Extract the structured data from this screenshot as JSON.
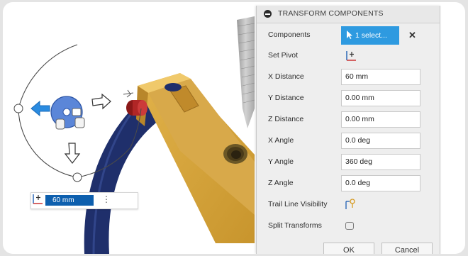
{
  "float_bar": {
    "distance_value": "60 mm"
  },
  "panel": {
    "title": "TRANSFORM COMPONENTS",
    "rows": {
      "components": {
        "label": "Components",
        "value": "1 select..."
      },
      "set_pivot": {
        "label": "Set Pivot"
      },
      "x_distance": {
        "label": "X Distance",
        "value": "60 mm"
      },
      "y_distance": {
        "label": "Y Distance",
        "value": "0.00 mm"
      },
      "z_distance": {
        "label": "Z Distance",
        "value": "0.00 mm"
      },
      "x_angle": {
        "label": "X Angle",
        "value": "0.0 deg"
      },
      "y_angle": {
        "label": "Y Angle",
        "value": "360 deg"
      },
      "z_angle": {
        "label": "Z Angle",
        "value": "0.0 deg"
      },
      "trail": {
        "label": "Trail Line Visibility"
      },
      "split": {
        "label": "Split Transforms"
      }
    },
    "clear_glyph": "✕",
    "ok_label": "OK",
    "cancel_label": "Cancel"
  },
  "colors": {
    "accent": "#2e9ae0",
    "float_input": "#0d5fae",
    "yellow_part": "#d7a53b",
    "navy_part": "#1f2f6b",
    "manipulator": "#5b86d8"
  },
  "icons": [
    "collapse-icon",
    "cursor-icon",
    "close-icon",
    "pivot-icon",
    "trail-line-icon",
    "arrow-icon",
    "rotate-icon"
  ]
}
